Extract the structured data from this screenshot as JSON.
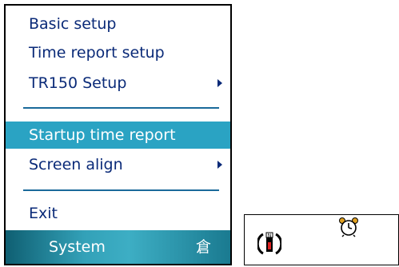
{
  "menu": {
    "items": [
      {
        "label": "Basic setup"
      },
      {
        "label": "Time report setup"
      },
      {
        "label": "TR150 Setup"
      },
      {
        "label": "Startup time report"
      },
      {
        "label": "Screen align"
      },
      {
        "label": "Exit"
      }
    ]
  },
  "taskbar": {
    "label": "System",
    "keyboard_glyph": "倉"
  },
  "tray": {
    "icons": [
      "notification-icon",
      "alarm-clock-icon"
    ]
  },
  "colors": {
    "selection": "#2aa3c3",
    "menu_text": "#0a2a78",
    "taskbar": "#33a1b8"
  }
}
